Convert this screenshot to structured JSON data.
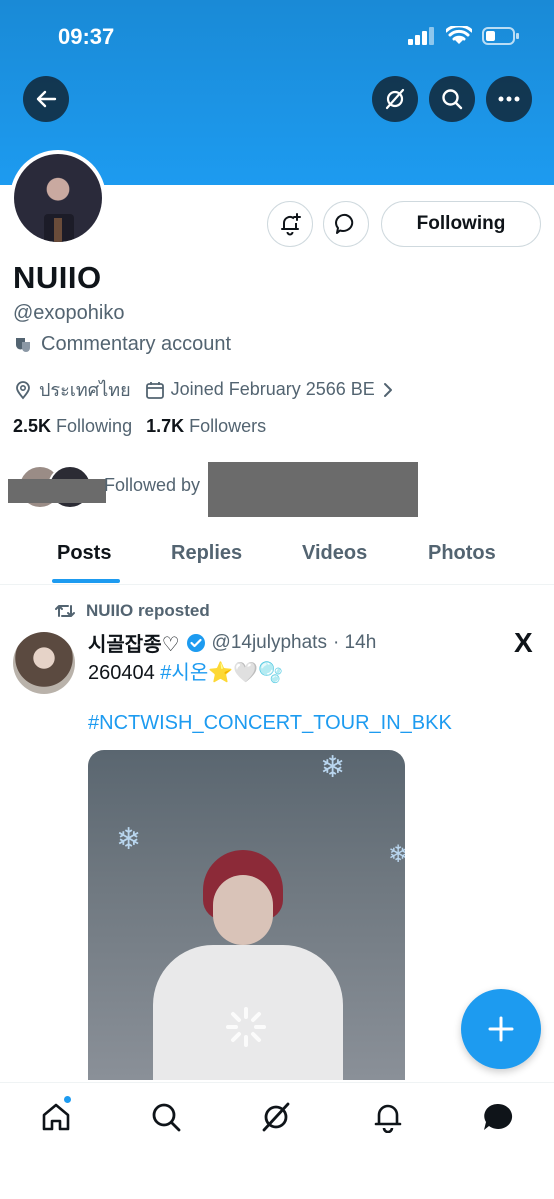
{
  "status_bar": {
    "time": "09:37"
  },
  "profile": {
    "display_name": "NUIIO",
    "handle": "@exopohiko",
    "category": "Commentary account",
    "location": "ประเทศไทย",
    "joined": "Joined February 2566 BE",
    "following_count": "2.5K",
    "following_label": "Following",
    "followers_count": "1.7K",
    "followers_label": "Followers",
    "followed_by": "Followed by"
  },
  "actions": {
    "following_button": "Following"
  },
  "tabs": [
    {
      "label": "Posts"
    },
    {
      "label": "Replies"
    },
    {
      "label": "Videos"
    },
    {
      "label": "Photos"
    }
  ],
  "post": {
    "repost_label": "NUIIO reposted",
    "author_name": "시골잡종♡",
    "author_handle": "@14julyphats",
    "time": "· 14h",
    "text_prefix": "260404 ",
    "hashtag_1": "#시온",
    "emoji_suffix": "⭐🤍🫧",
    "hashtag_2": "#NCTWISH_CONCERT_TOUR_IN_BKK",
    "source_logo": "X"
  },
  "colors": {
    "accent": "#1d9bf0",
    "banner": "#1d9bf0",
    "text_secondary": "#536471"
  },
  "icons": {
    "header": [
      "back-arrow-icon",
      "grok-icon",
      "search-icon",
      "more-icon"
    ],
    "bottom_nav": [
      "home-icon",
      "search-icon",
      "grok-icon",
      "notifications-icon",
      "messages-icon"
    ],
    "fab": "plus-icon"
  }
}
